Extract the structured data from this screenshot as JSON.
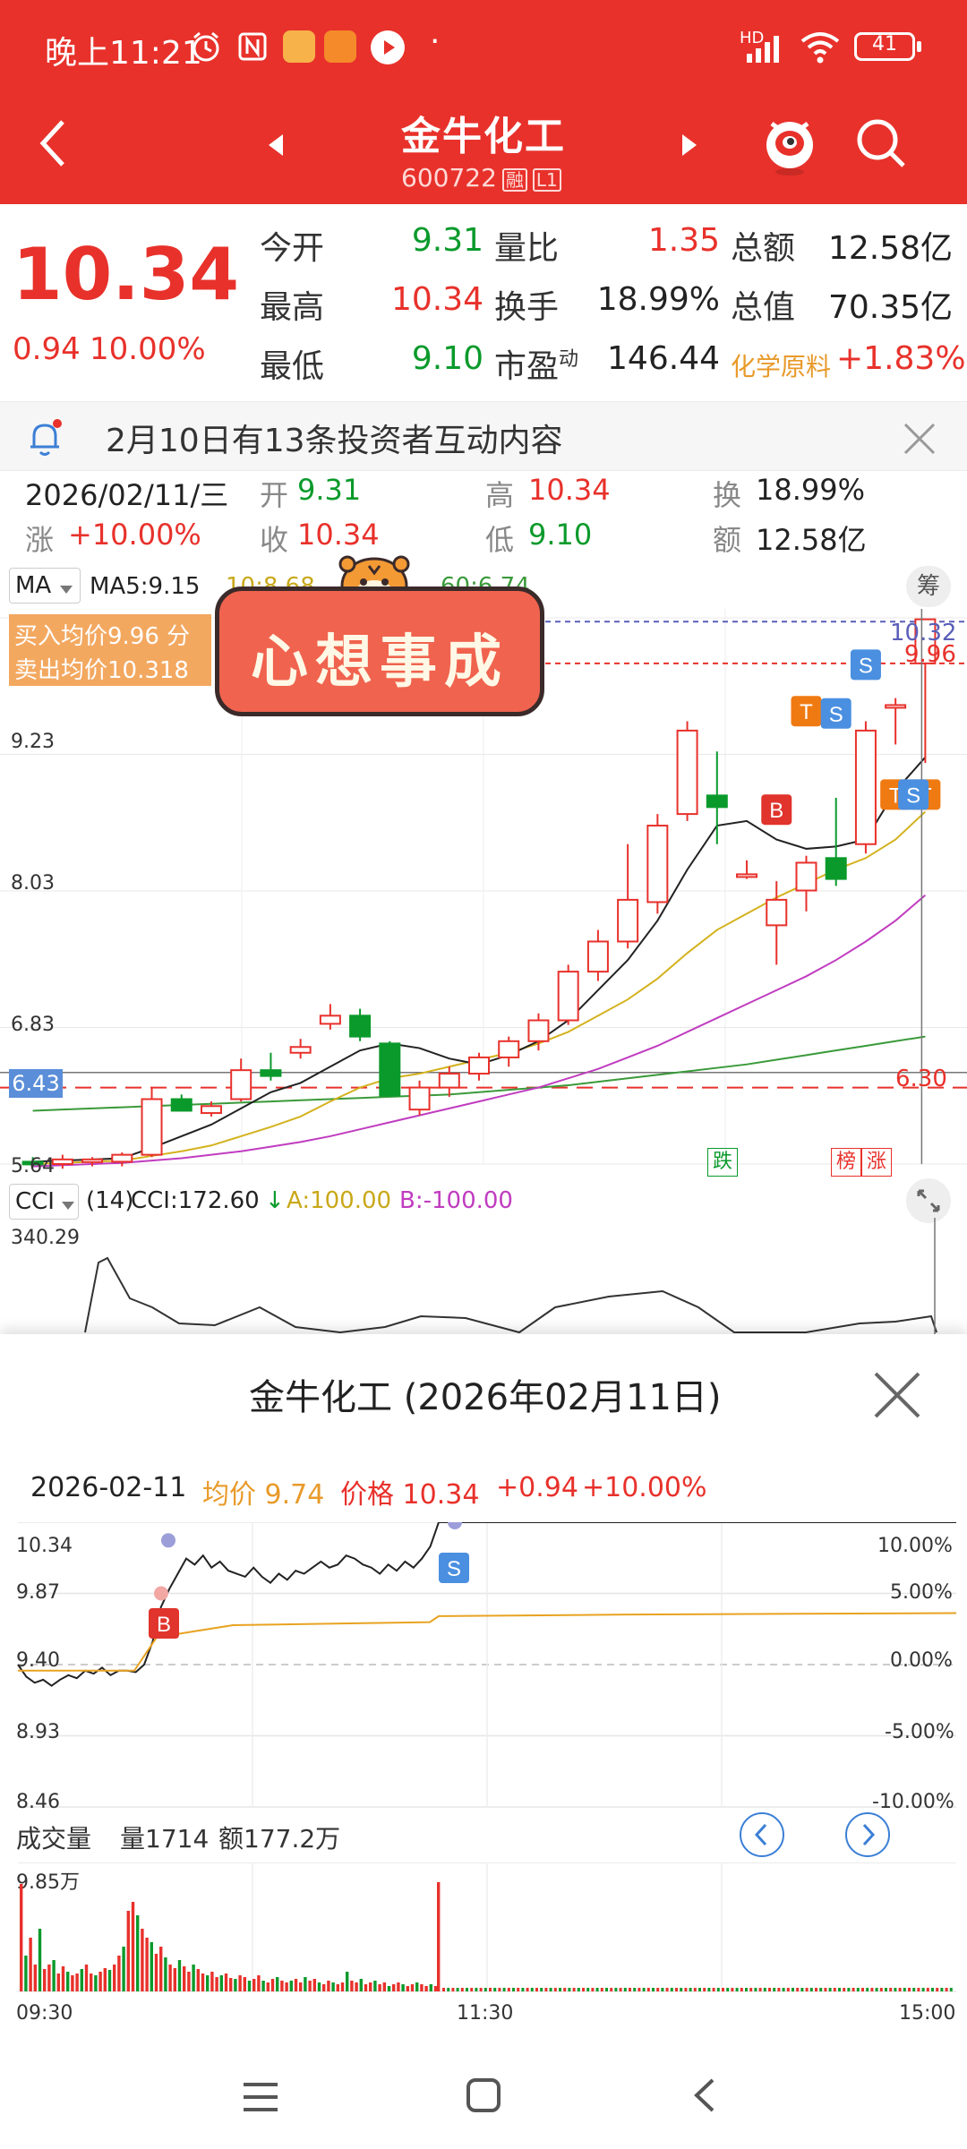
{
  "status_bar": {
    "time": "晚上11:21",
    "network": "HD",
    "battery": "41"
  },
  "header": {
    "title": "金牛化工",
    "code": "600722",
    "tag_rong": "融",
    "tag_l1": "L1"
  },
  "quote": {
    "price": "10.34",
    "change": "0.94",
    "change_pct": "10.00%",
    "rows": [
      {
        "l1": "今开",
        "v1": "9.31",
        "l2": "量比",
        "v2": "1.35",
        "l3": "总额",
        "v3": "12.58亿"
      },
      {
        "l1": "最高",
        "v1": "10.34",
        "l2": "换手",
        "v2": "18.99%",
        "l3": "总值",
        "v3": "70.35亿"
      },
      {
        "l1": "最低",
        "v1": "9.10",
        "l2": "市盈",
        "l2sup": "动",
        "v2": "146.44",
        "l3": "化学原料",
        "v3": "+1.83%"
      }
    ]
  },
  "notice": {
    "text": "2月10日有13条投资者互动内容"
  },
  "day_info": {
    "date": "2026/02/11/三",
    "open_label": "开",
    "open": "9.31",
    "high_label": "高",
    "high": "10.34",
    "turn_label": "换",
    "turn": "18.99%",
    "chg_label": "涨",
    "chg": "+10.00%",
    "close_label": "收",
    "close": "10.34",
    "low_label": "低",
    "low": "9.10",
    "amt_label": "额",
    "amt": "12.58亿"
  },
  "kline": {
    "ma_selector": "MA",
    "ma5": "MA5:9.15",
    "ma10": "10:8.68",
    "ma60": "60:6.74",
    "chip_button": "筹",
    "buy_avg": "买入均价9.96 分",
    "sell_avg": "卖出均价10.318",
    "right_top": "10.32",
    "right_sub": "9.96",
    "y_labels": [
      "9.23",
      "8.03",
      "6.83",
      "5.64"
    ],
    "cursor_price": "6.43",
    "low_line": "6.30",
    "markers": [
      "跌",
      "榜",
      "涨"
    ],
    "sticker": "心想事成"
  },
  "cci": {
    "selector": "CCI",
    "period": "(14)",
    "value": "CCI:172.60",
    "a": "A:100.00",
    "b": "B:-100.00",
    "top": "340.29"
  },
  "popup": {
    "title": "金牛化工 (2026年02月11日)",
    "date": "2026-02-11",
    "avg_label": "均价 9.74",
    "price_label": "价格 10.34",
    "change": "+0.94",
    "pct": "+10.00%",
    "left_axis": [
      "10.34",
      "9.87",
      "9.40",
      "8.93",
      "8.46"
    ],
    "right_axis": [
      "10.00%",
      "5.00%",
      "0.00%",
      "-5.00%",
      "-10.00%"
    ],
    "vol_title": "成交量",
    "vol": "量1714",
    "amount": "额177.2万",
    "vol_top": "9.85万",
    "times": [
      "09:30",
      "11:30",
      "15:00"
    ]
  },
  "colors": {
    "brand": "#e8312b",
    "up": "#e8312b",
    "down": "#0a9a2b",
    "ma5": "#222222",
    "ma10": "#d4b21e",
    "ma20": "#c03cc0",
    "ma60": "#3a9a3a"
  },
  "chart_data": {
    "type": "candlestick",
    "ohlc": [
      {
        "o": 5.66,
        "h": 5.7,
        "l": 5.62,
        "c": 5.64
      },
      {
        "o": 5.64,
        "h": 5.72,
        "l": 5.6,
        "c": 5.68
      },
      {
        "o": 5.66,
        "h": 5.7,
        "l": 5.62,
        "c": 5.68
      },
      {
        "o": 5.66,
        "h": 5.74,
        "l": 5.62,
        "c": 5.72
      },
      {
        "o": 5.72,
        "h": 6.3,
        "l": 5.7,
        "c": 6.2
      },
      {
        "o": 6.2,
        "h": 6.24,
        "l": 6.1,
        "c": 6.1
      },
      {
        "o": 6.08,
        "h": 6.18,
        "l": 6.05,
        "c": 6.14
      },
      {
        "o": 6.2,
        "h": 6.55,
        "l": 6.18,
        "c": 6.45
      },
      {
        "o": 6.45,
        "h": 6.6,
        "l": 6.36,
        "c": 6.4
      },
      {
        "o": 6.6,
        "h": 6.72,
        "l": 6.55,
        "c": 6.65
      },
      {
        "o": 6.85,
        "h": 7.02,
        "l": 6.8,
        "c": 6.92
      },
      {
        "o": 6.92,
        "h": 6.98,
        "l": 6.7,
        "c": 6.74
      },
      {
        "o": 6.68,
        "h": 6.7,
        "l": 6.22,
        "c": 6.23
      },
      {
        "o": 6.11,
        "h": 6.36,
        "l": 6.06,
        "c": 6.3
      },
      {
        "o": 6.3,
        "h": 6.48,
        "l": 6.22,
        "c": 6.42
      },
      {
        "o": 6.42,
        "h": 6.6,
        "l": 6.36,
        "c": 6.56
      },
      {
        "o": 6.56,
        "h": 6.74,
        "l": 6.48,
        "c": 6.7
      },
      {
        "o": 6.7,
        "h": 6.94,
        "l": 6.62,
        "c": 6.88
      },
      {
        "o": 6.88,
        "h": 7.36,
        "l": 6.84,
        "c": 7.3
      },
      {
        "o": 7.3,
        "h": 7.66,
        "l": 7.22,
        "c": 7.56
      },
      {
        "o": 7.56,
        "h": 8.4,
        "l": 7.5,
        "c": 7.92
      },
      {
        "o": 7.9,
        "h": 8.66,
        "l": 7.8,
        "c": 8.56
      },
      {
        "o": 8.66,
        "h": 9.46,
        "l": 8.6,
        "c": 9.38
      },
      {
        "o": 8.82,
        "h": 9.2,
        "l": 8.4,
        "c": 8.72
      },
      {
        "o": 8.12,
        "h": 8.26,
        "l": 8.1,
        "c": 8.14
      },
      {
        "o": 7.7,
        "h": 8.08,
        "l": 7.36,
        "c": 7.92
      },
      {
        "o": 8.0,
        "h": 8.3,
        "l": 7.82,
        "c": 8.24
      },
      {
        "o": 8.28,
        "h": 8.8,
        "l": 8.04,
        "c": 8.1
      },
      {
        "o": 8.4,
        "h": 9.46,
        "l": 8.32,
        "c": 9.38
      },
      {
        "o": 9.58,
        "h": 9.66,
        "l": 9.26,
        "c": 9.6
      },
      {
        "o": 9.96,
        "h": 10.34,
        "l": 9.1,
        "c": 10.34
      }
    ],
    "ma5": [
      5.66,
      5.67,
      5.68,
      5.69,
      5.78,
      5.88,
      5.98,
      6.12,
      6.26,
      6.34,
      6.48,
      6.62,
      6.68,
      6.64,
      6.55,
      6.5,
      6.58,
      6.7,
      6.88,
      7.14,
      7.4,
      7.74,
      8.18,
      8.56,
      8.6,
      8.44,
      8.36,
      8.38,
      8.44,
      8.86,
      9.15
    ],
    "ma10": [
      5.64,
      5.65,
      5.66,
      5.67,
      5.71,
      5.75,
      5.8,
      5.88,
      5.96,
      6.05,
      6.18,
      6.3,
      6.38,
      6.42,
      6.48,
      6.54,
      6.6,
      6.68,
      6.78,
      6.92,
      7.06,
      7.24,
      7.46,
      7.66,
      7.8,
      7.94,
      8.06,
      8.18,
      8.28,
      8.44,
      8.68
    ],
    "ma20": [
      5.62,
      5.63,
      5.64,
      5.65,
      5.67,
      5.69,
      5.72,
      5.75,
      5.79,
      5.83,
      5.88,
      5.94,
      6.0,
      6.06,
      6.12,
      6.18,
      6.24,
      6.3,
      6.38,
      6.46,
      6.56,
      6.66,
      6.78,
      6.9,
      7.02,
      7.14,
      7.26,
      7.4,
      7.56,
      7.74,
      7.96
    ],
    "ma60": [
      6.1,
      6.11,
      6.12,
      6.13,
      6.14,
      6.15,
      6.16,
      6.17,
      6.18,
      6.19,
      6.2,
      6.21,
      6.22,
      6.23,
      6.24,
      6.26,
      6.28,
      6.3,
      6.32,
      6.35,
      6.38,
      6.41,
      6.44,
      6.47,
      6.5,
      6.54,
      6.58,
      6.62,
      6.66,
      6.7,
      6.74
    ],
    "ylim": [
      5.64,
      10.43
    ]
  }
}
